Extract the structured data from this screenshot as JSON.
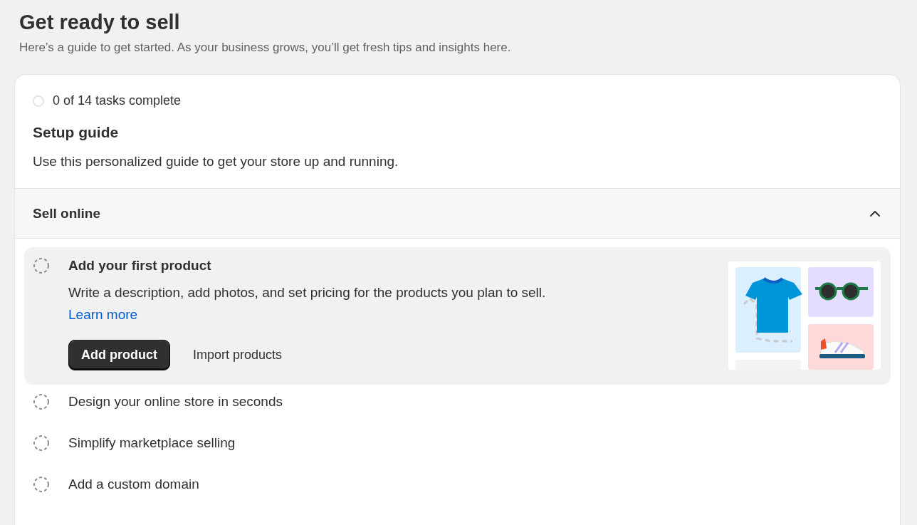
{
  "page": {
    "title": "Get ready to sell",
    "subtitle": "Here’s a guide to get started. As your business grows, you’ll get fresh tips and insights here."
  },
  "guide": {
    "progress": "0 of 14 tasks complete",
    "title": "Setup guide",
    "description": "Use this personalized guide to get your store up and running."
  },
  "section": {
    "title": "Sell online",
    "expanded": true,
    "tasks": [
      {
        "title": "Add your first product",
        "expanded": true,
        "description": "Write a description, add photos, and set pricing for the products you plan to sell.",
        "link": "Learn more",
        "primary_button": "Add product",
        "secondary_button": "Import products"
      },
      {
        "title": "Design your online store in seconds",
        "expanded": false
      },
      {
        "title": "Simplify marketplace selling",
        "expanded": false
      },
      {
        "title": "Add a custom domain",
        "expanded": false
      }
    ]
  }
}
